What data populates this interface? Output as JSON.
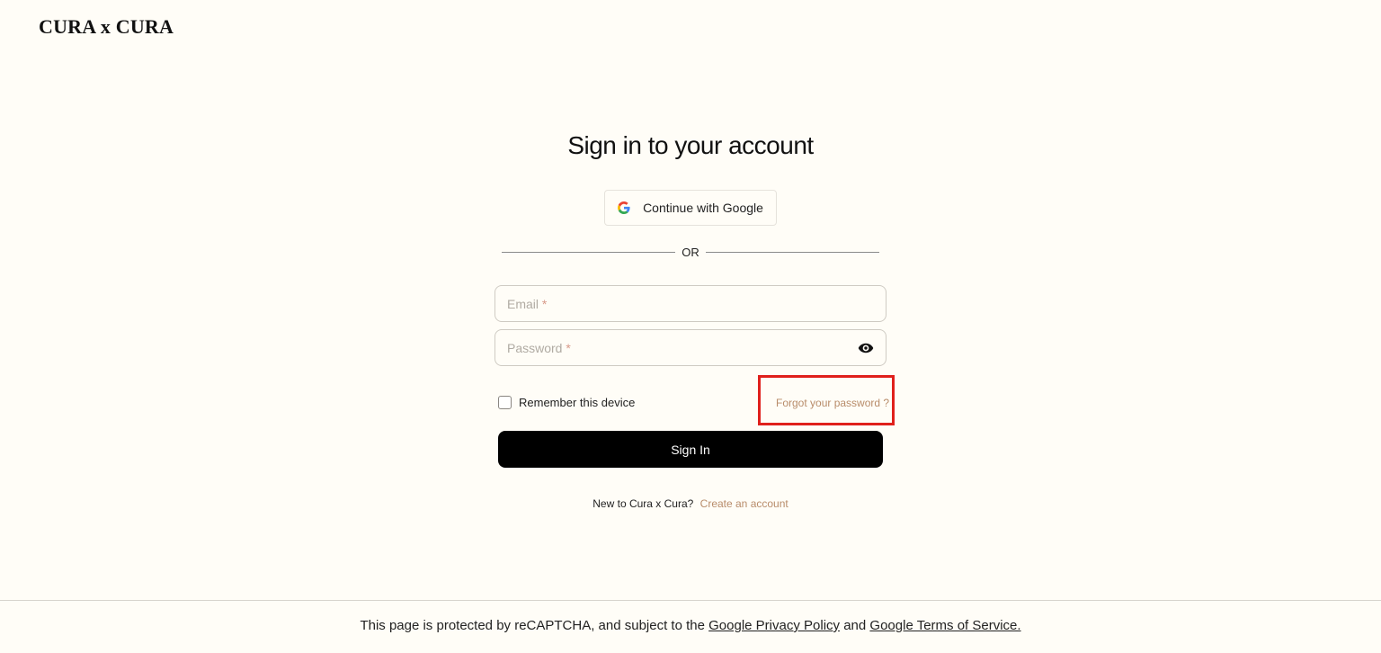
{
  "brand": {
    "logo_text": "CURA x CURA"
  },
  "signin": {
    "title": "Sign in to your account",
    "google_button_label": "Continue with Google",
    "divider_text": "OR",
    "email_placeholder": "Email",
    "password_placeholder": "Password",
    "required_marker": "*",
    "remember_label": "Remember this device",
    "remember_checked": false,
    "forgot_label": "Forgot your password ?",
    "submit_label": "Sign In",
    "new_user_prompt": "New to Cura x Cura?",
    "create_account_label": "Create an account"
  },
  "footer": {
    "prefix": "This page is protected by reCAPTCHA, and subject to the",
    "privacy_link": "Google Privacy Policy",
    "and_text": "and",
    "terms_link": "Google Terms of Service."
  },
  "colors": {
    "background": "#fffdf7",
    "accent_link": "#b88c6a",
    "primary_button": "#000000",
    "highlight_box": "#e0201c"
  },
  "icons": {
    "google": "google-g-icon",
    "password_visibility": "eye-icon"
  }
}
